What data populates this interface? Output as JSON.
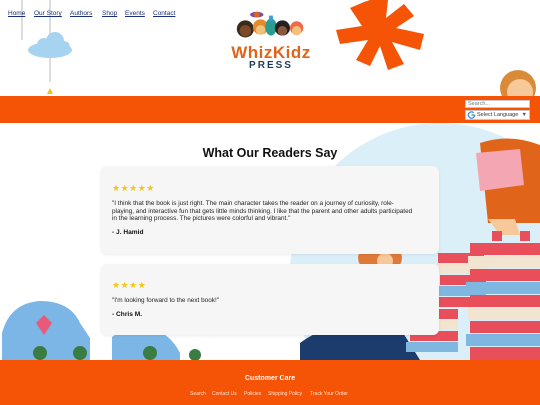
{
  "brand": {
    "name": "WhizKidz",
    "sub": "PRESS"
  },
  "nav": {
    "items": [
      "Home",
      "Our Story",
      "Authors",
      "Shop",
      "Events",
      "Contact"
    ]
  },
  "search": {
    "placeholder": "Search..."
  },
  "language": {
    "label": "Select Language",
    "arrow": "▼"
  },
  "reviews": {
    "title": "What Our Readers Say",
    "items": [
      {
        "stars": "★★★★★",
        "line1": "\"I think that the book is just right. The main character takes the reader on a journey of curiosity, role-",
        "line2": "playing, and interactive fun that gets little minds thinking. I like that the parent and other adults participated",
        "line3": "in the learning process. The pictures were colorful and vibrant.\"",
        "author": "- J. Hamid"
      },
      {
        "stars": "★★★★",
        "line1": "\"I'm looking forward to the next book!\"",
        "author": "- Chris M."
      }
    ]
  },
  "footer": {
    "title": "Customer Care",
    "links": [
      "Search",
      "Contact Us",
      "Policies",
      "Shipping Policy",
      "Track Your Order"
    ]
  },
  "colors": {
    "accent": "#f55306",
    "nav_link": "#1a2e7a",
    "star": "#f5c518",
    "card": "#f6f6f6"
  }
}
